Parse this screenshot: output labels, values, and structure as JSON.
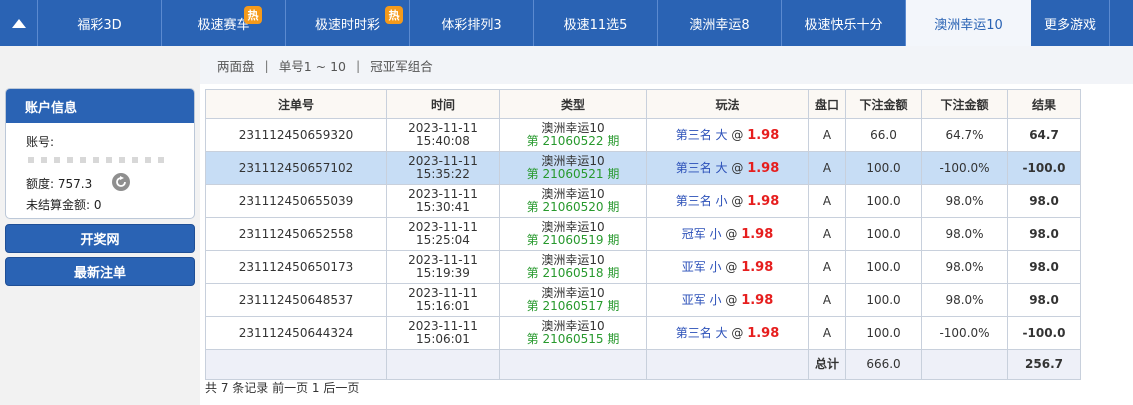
{
  "nav": {
    "tabs": [
      {
        "label": "福彩3D",
        "hot": false,
        "active": false
      },
      {
        "label": "极速赛车",
        "hot": true,
        "active": false
      },
      {
        "label": "极速时时彩",
        "hot": true,
        "active": false
      },
      {
        "label": "体彩排列3",
        "hot": false,
        "active": false
      },
      {
        "label": "极速11选5",
        "hot": false,
        "active": false
      },
      {
        "label": "澳洲幸运8",
        "hot": false,
        "active": false
      },
      {
        "label": "极速快乐十分",
        "hot": false,
        "active": false
      },
      {
        "label": "澳洲幸运10",
        "hot": false,
        "active": true
      },
      {
        "label": "更多游戏",
        "hot": false,
        "active": false
      }
    ],
    "hot_label": "热"
  },
  "subnav": {
    "items": [
      "两面盘",
      "单号1 ~ 10",
      "冠亚军组合"
    ],
    "separator": "|"
  },
  "account": {
    "title": "账户信息",
    "account_label": "账号:",
    "credit_label": "额度:",
    "credit_value": "757.3",
    "unsettled_label": "未结算金额:",
    "unsettled_value": "0"
  },
  "side_buttons": {
    "lottery_site": "开奖网",
    "latest_bets": "最新注单"
  },
  "table": {
    "headers": [
      "注单号",
      "时间",
      "类型",
      "玩法",
      "盘口",
      "下注金额",
      "下注金额",
      "结果"
    ],
    "rows": [
      {
        "id": "231112450659320",
        "date": "2023-11-11",
        "time": "15:40:08",
        "type": "澳洲幸运10",
        "issue": "第 21060522 期",
        "play": "第三名 大",
        "at": "@",
        "odds": "1.98",
        "pan": "A",
        "amount": "66.0",
        "pct": "64.7%",
        "result": "64.7",
        "negative": false
      },
      {
        "id": "231112450657102",
        "date": "2023-11-11",
        "time": "15:35:22",
        "type": "澳洲幸运10",
        "issue": "第 21060521 期",
        "play": "第三名 大",
        "at": "@",
        "odds": "1.98",
        "pan": "A",
        "amount": "100.0",
        "pct": "-100.0%",
        "result": "-100.0",
        "negative": true
      },
      {
        "id": "231112450655039",
        "date": "2023-11-11",
        "time": "15:30:41",
        "type": "澳洲幸运10",
        "issue": "第 21060520 期",
        "play": "第三名 小",
        "at": "@",
        "odds": "1.98",
        "pan": "A",
        "amount": "100.0",
        "pct": "98.0%",
        "result": "98.0",
        "negative": false
      },
      {
        "id": "231112450652558",
        "date": "2023-11-11",
        "time": "15:25:04",
        "type": "澳洲幸运10",
        "issue": "第 21060519 期",
        "play": "冠军 小",
        "at": "@",
        "odds": "1.98",
        "pan": "A",
        "amount": "100.0",
        "pct": "98.0%",
        "result": "98.0",
        "negative": false
      },
      {
        "id": "231112450650173",
        "date": "2023-11-11",
        "time": "15:19:39",
        "type": "澳洲幸运10",
        "issue": "第 21060518 期",
        "play": "亚军 小",
        "at": "@",
        "odds": "1.98",
        "pan": "A",
        "amount": "100.0",
        "pct": "98.0%",
        "result": "98.0",
        "negative": false
      },
      {
        "id": "231112450648537",
        "date": "2023-11-11",
        "time": "15:16:01",
        "type": "澳洲幸运10",
        "issue": "第 21060517 期",
        "play": "亚军 小",
        "at": "@",
        "odds": "1.98",
        "pan": "A",
        "amount": "100.0",
        "pct": "98.0%",
        "result": "98.0",
        "negative": false
      },
      {
        "id": "231112450644324",
        "date": "2023-11-11",
        "time": "15:06:01",
        "type": "澳洲幸运10",
        "issue": "第 21060515 期",
        "play": "第三名 大",
        "at": "@",
        "odds": "1.98",
        "pan": "A",
        "amount": "100.0",
        "pct": "-100.0%",
        "result": "-100.0",
        "negative": true
      }
    ],
    "total_label": "总计",
    "total_amount": "666.0",
    "total_result": "256.7"
  },
  "footer": {
    "records": "共 7 条记录 前一页 1 后一页"
  },
  "colors": {
    "primary": "#2a63b4",
    "hot_badge": "#f59a1a",
    "issue_green": "#27992d",
    "odds_red": "#e61e1e",
    "result_blue": "#2a4fc8",
    "selected_row": "#c7ddf5"
  },
  "icons": {
    "nav_toggle": "caret-up-icon",
    "refresh": "refresh-icon"
  }
}
